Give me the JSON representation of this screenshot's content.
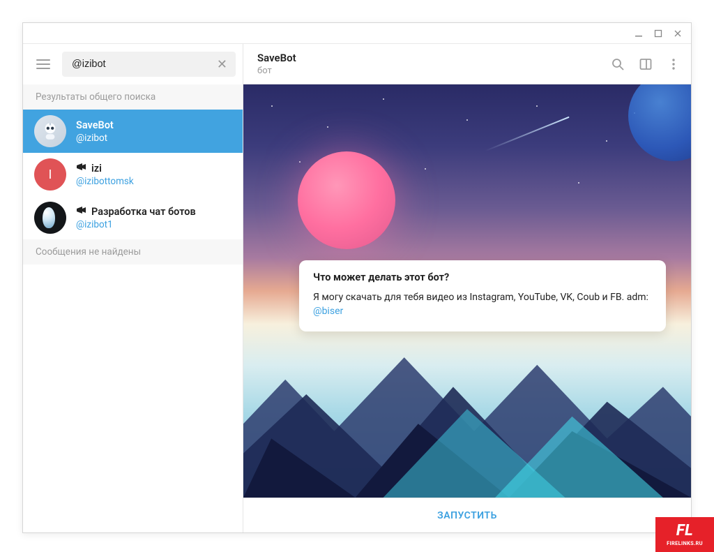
{
  "search": {
    "value": "@izibot"
  },
  "sidebar": {
    "section_global": "Результаты общего поиска",
    "section_empty": "Сообщения не найдены",
    "results": [
      {
        "name": "SaveBot",
        "handle": "@izibot",
        "icon": ""
      },
      {
        "name": "izi",
        "handle": "@izibottomsk",
        "icon": "megaphone"
      },
      {
        "name": "Разработка чат ботов",
        "handle": "@izibot1",
        "icon": "megaphone"
      }
    ]
  },
  "chat": {
    "title": "SaveBot",
    "subtitle": "бот",
    "info_title": "Что может делать этот бот?",
    "info_body_pre": "Я могу скачать для тебя видео из Instagram, YouTube, VK, Coub и FB. adm: ",
    "info_link": "@biser",
    "start": "ЗАПУСТИТЬ"
  },
  "watermark": {
    "big": "FL",
    "small": "FIRELINKS.RU"
  },
  "avatar_letter_1": "I"
}
